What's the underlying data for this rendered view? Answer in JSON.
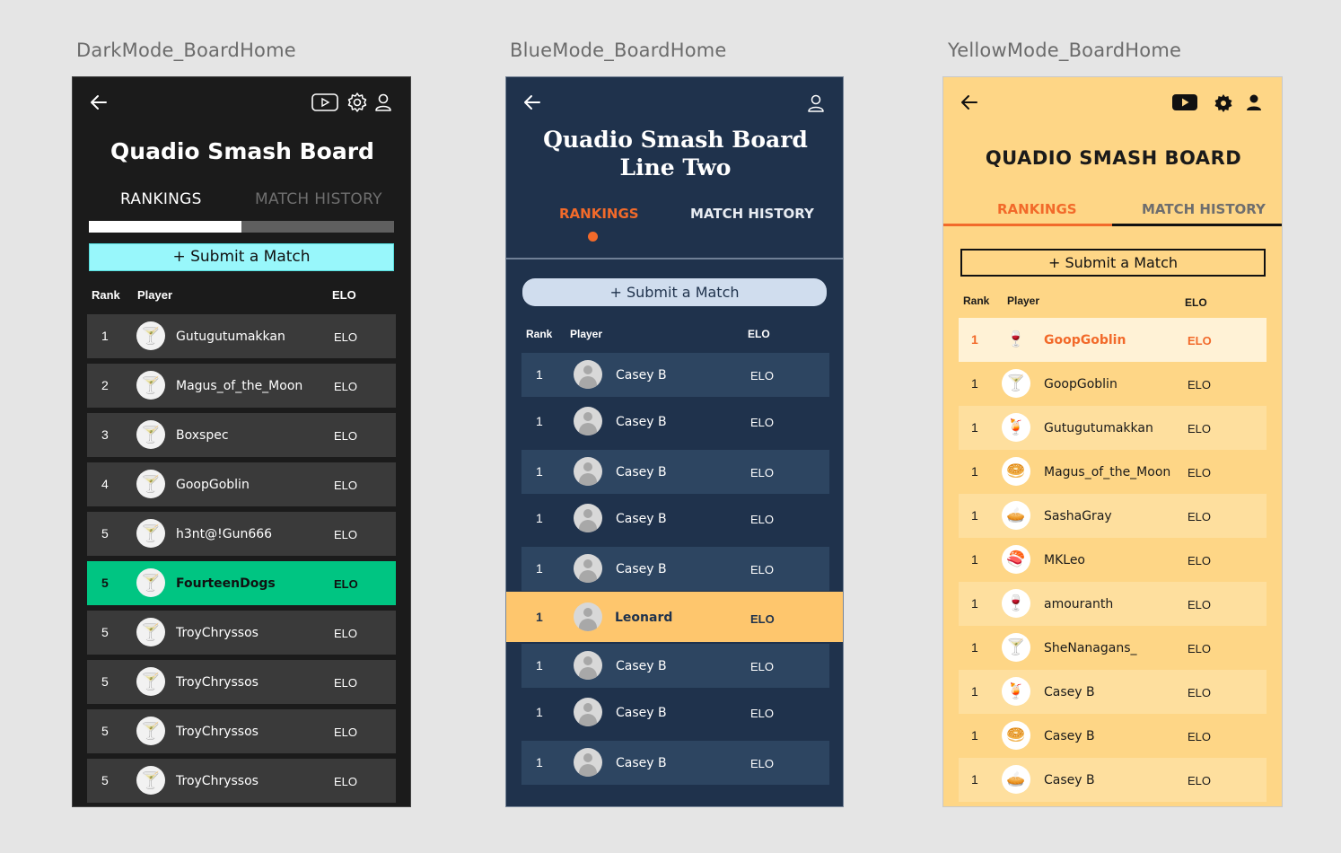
{
  "labels": {
    "dark": "DarkMode_BoardHome",
    "blue": "BlueMode_BoardHome",
    "yellow": "YellowMode_BoardHome"
  },
  "colors": {
    "dark_bg": "#1b1b1b",
    "dark_accent": "#98f7fb",
    "dark_highlight": "#00c582",
    "blue_bg": "#1f324c",
    "blue_accent": "#f26a2a",
    "blue_highlight": "#fec66d",
    "yellow_bg": "#fed686",
    "yellow_accent": "#f26a2a"
  },
  "common": {
    "rankings": "RANKINGS",
    "match_history": "MATCH HISTORY",
    "submit": "+ Submit a Match",
    "col_rank": "Rank",
    "col_player": "Player",
    "col_elo": "ELO"
  },
  "dark": {
    "title": "Quadio Smash Board",
    "rows": [
      {
        "rank": "1",
        "name": "Gutugutumakkan",
        "elo": "ELO",
        "icon": "🍸"
      },
      {
        "rank": "2",
        "name": "Magus_of_the_Moon",
        "elo": "ELO",
        "icon": "🍸"
      },
      {
        "rank": "3",
        "name": "Boxspec",
        "elo": "ELO",
        "icon": "🍸"
      },
      {
        "rank": "4",
        "name": "GoopGoblin",
        "elo": "ELO",
        "icon": "🍸"
      },
      {
        "rank": "5",
        "name": "h3nt@!Gun666",
        "elo": "ELO",
        "icon": "🍸"
      },
      {
        "rank": "5",
        "name": "FourteenDogs",
        "elo": "ELO",
        "icon": "🍸"
      },
      {
        "rank": "5",
        "name": "TroyChryssos",
        "elo": "ELO",
        "icon": "🍸"
      },
      {
        "rank": "5",
        "name": "TroyChryssos",
        "elo": "ELO",
        "icon": "🍸"
      },
      {
        "rank": "5",
        "name": "TroyChryssos",
        "elo": "ELO",
        "icon": "🍸"
      },
      {
        "rank": "5",
        "name": "TroyChryssos",
        "elo": "ELO",
        "icon": "🍸"
      }
    ]
  },
  "blue": {
    "title_line1": "Quadio Smash Board",
    "title_line2": "Line Two",
    "rows": [
      {
        "rank": "1",
        "name": "Casey B",
        "elo": "ELO"
      },
      {
        "rank": "1",
        "name": "Casey B",
        "elo": "ELO"
      },
      {
        "rank": "1",
        "name": "Casey B",
        "elo": "ELO"
      },
      {
        "rank": "1",
        "name": "Casey B",
        "elo": "ELO"
      },
      {
        "rank": "1",
        "name": "Casey B",
        "elo": "ELO"
      },
      {
        "rank": "1",
        "name": "Leonard",
        "elo": "ELO"
      },
      {
        "rank": "1",
        "name": "Casey B",
        "elo": "ELO"
      },
      {
        "rank": "1",
        "name": "Casey B",
        "elo": "ELO"
      },
      {
        "rank": "1",
        "name": "Casey B",
        "elo": "ELO"
      }
    ]
  },
  "yellow": {
    "title": "QUADIO SMASH BOARD",
    "rows": [
      {
        "rank": "1",
        "name": "GoopGoblin",
        "elo": "ELO",
        "icon": "🍷"
      },
      {
        "rank": "1",
        "name": "GoopGoblin",
        "elo": "ELO",
        "icon": "🍸"
      },
      {
        "rank": "1",
        "name": "Gutugutumakkan",
        "elo": "ELO",
        "icon": "🍹"
      },
      {
        "rank": "1",
        "name": "Magus_of_the_Moon",
        "elo": "ELO",
        "icon": "🥯"
      },
      {
        "rank": "1",
        "name": "SashaGray",
        "elo": "ELO",
        "icon": "🥧"
      },
      {
        "rank": "1",
        "name": "MKLeo",
        "elo": "ELO",
        "icon": "🍣"
      },
      {
        "rank": "1",
        "name": "amouranth",
        "elo": "ELO",
        "icon": "🍷"
      },
      {
        "rank": "1",
        "name": "SheNanagans_",
        "elo": "ELO",
        "icon": "🍸"
      },
      {
        "rank": "1",
        "name": "Casey B",
        "elo": "ELO",
        "icon": "🍹"
      },
      {
        "rank": "1",
        "name": "Casey B",
        "elo": "ELO",
        "icon": "🥯"
      },
      {
        "rank": "1",
        "name": "Casey B",
        "elo": "ELO",
        "icon": "🥧"
      }
    ]
  }
}
